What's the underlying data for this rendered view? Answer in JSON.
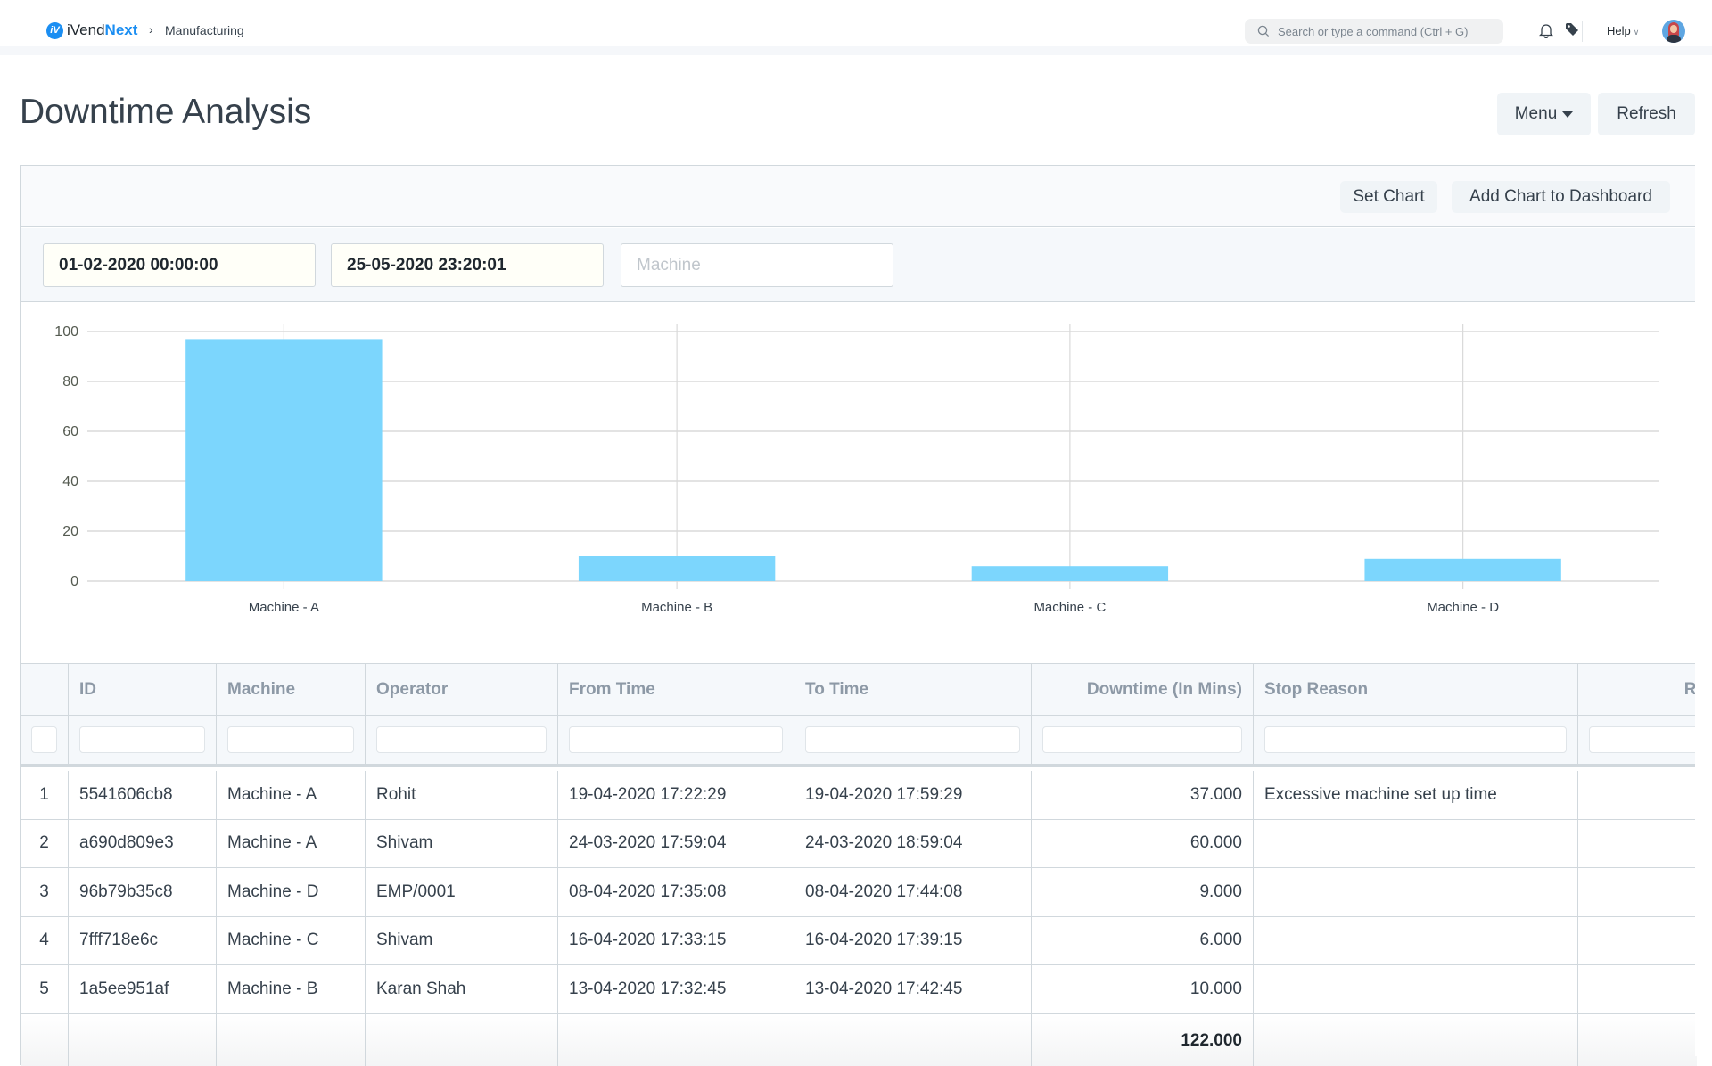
{
  "navbar": {
    "brand_prefix": "iVend",
    "brand_suffix": "Next",
    "logo_glyph": "iV",
    "breadcrumb_separator": "›",
    "breadcrumb": "Manufacturing",
    "search_placeholder": "Search or type a command (Ctrl + G)",
    "help_label": "Help",
    "icons": [
      "search-icon",
      "bell-icon",
      "tag-icon",
      "chevron-down-icon",
      "user-avatar"
    ]
  },
  "page": {
    "title": "Downtime Analysis",
    "menu_label": "Menu",
    "refresh_label": "Refresh"
  },
  "toolbar": {
    "set_chart_label": "Set Chart",
    "add_chart_label": "Add Chart to Dashboard"
  },
  "filters": {
    "from_date": "01-02-2020 00:00:00",
    "to_date": "25-05-2020 23:20:01",
    "machine_placeholder": "Machine"
  },
  "chart_data": {
    "type": "bar",
    "title": "",
    "xlabel": "",
    "ylabel": "",
    "categories": [
      "Machine - A",
      "Machine - B",
      "Machine - C",
      "Machine - D"
    ],
    "values": [
      97,
      10,
      6,
      9
    ],
    "yticks": [
      "0",
      "20",
      "40",
      "60",
      "80",
      "100"
    ],
    "ylim": [
      0,
      100
    ],
    "grid": true,
    "color": "#7cd6fd"
  },
  "table": {
    "columns": [
      "",
      "ID",
      "Machine",
      "Operator",
      "From Time",
      "To Time",
      "Downtime (In Mins)",
      "Stop Reason",
      "Remarks"
    ],
    "rows": [
      [
        "1",
        "5541606cb8",
        "Machine - A",
        "Rohit",
        "19-04-2020 17:22:29",
        "19-04-2020 17:59:29",
        "37.000",
        "Excessive machine set up time",
        ""
      ],
      [
        "2",
        "a690d809e3",
        "Machine - A",
        "Shivam",
        "24-03-2020 17:59:04",
        "24-03-2020 18:59:04",
        "60.000",
        "",
        ""
      ],
      [
        "3",
        "96b79b35c8",
        "Machine - D",
        "EMP/0001",
        "08-04-2020 17:35:08",
        "08-04-2020 17:44:08",
        "9.000",
        "",
        ""
      ],
      [
        "4",
        "7fff718e6c",
        "Machine - C",
        "Shivam",
        "16-04-2020 17:33:15",
        "16-04-2020 17:39:15",
        "6.000",
        "",
        ""
      ],
      [
        "5",
        "1a5ee951af",
        "Machine - B",
        "Karan Shah",
        "13-04-2020 17:32:45",
        "13-04-2020 17:42:45",
        "10.000",
        "",
        ""
      ]
    ],
    "total_downtime": "122.000"
  }
}
